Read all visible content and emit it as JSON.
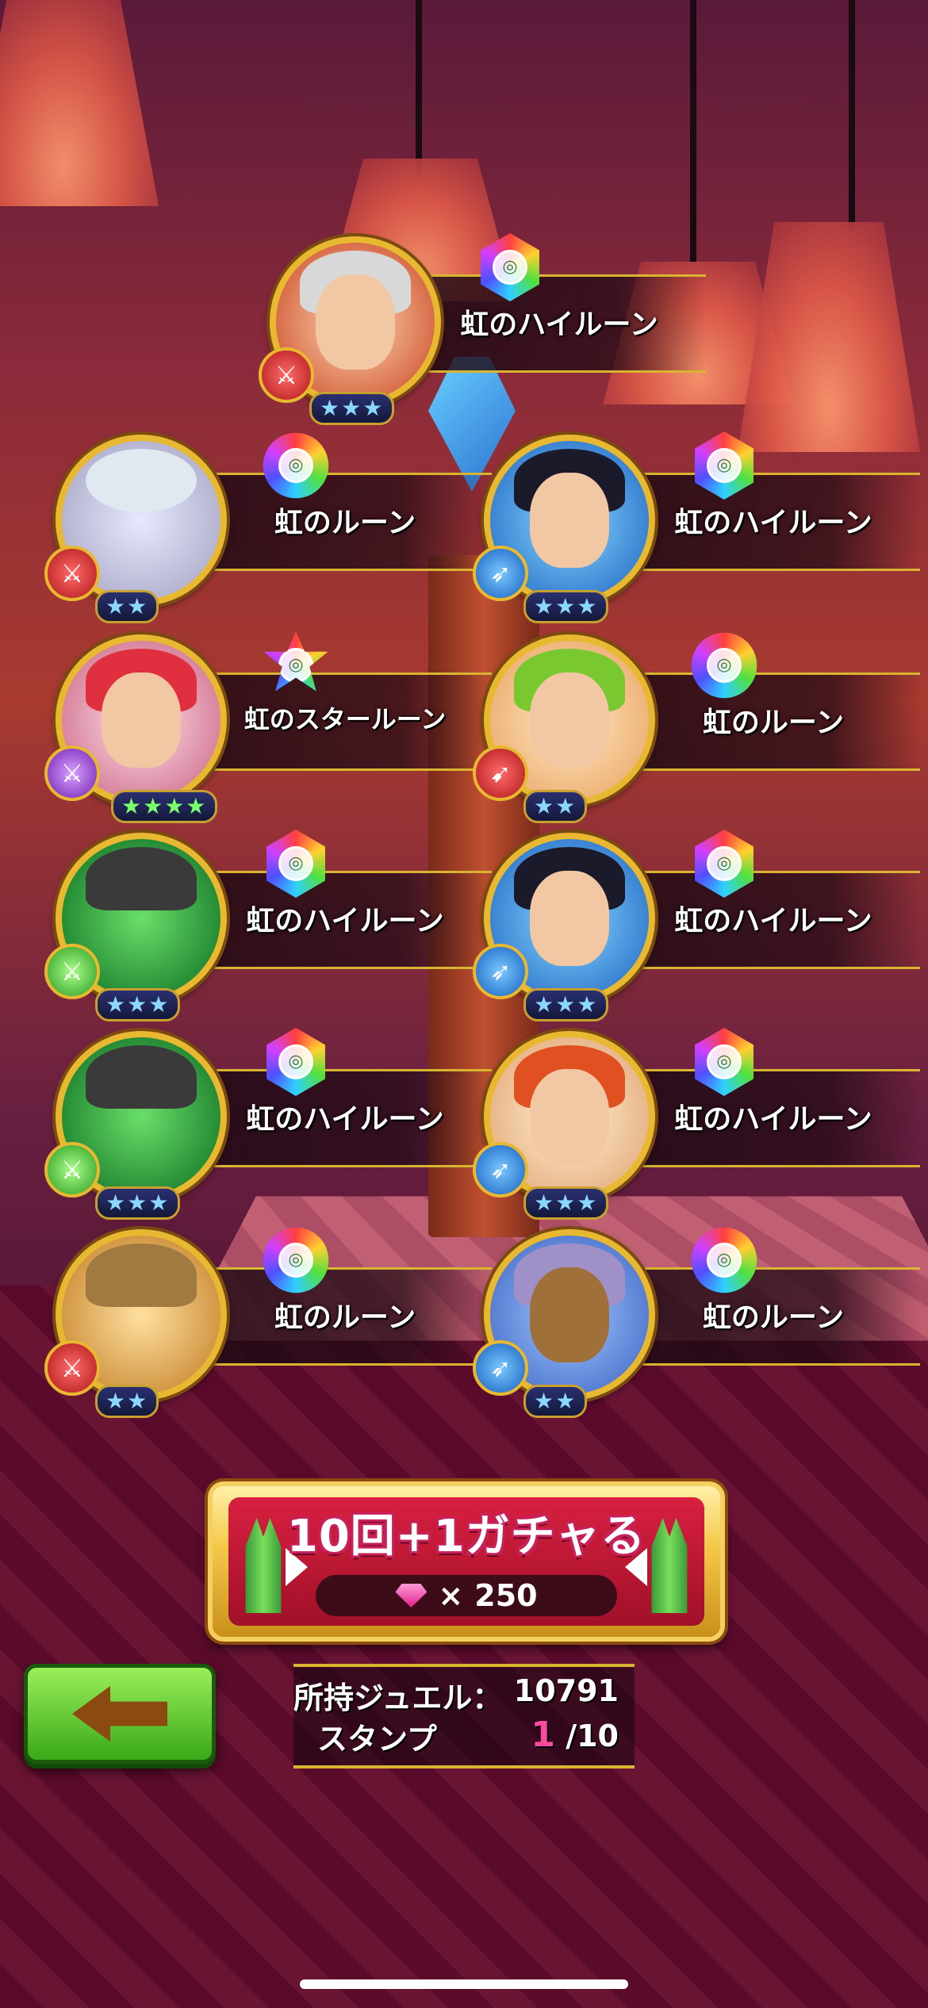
{
  "rewards": [
    {
      "name": "虹のハイルーン",
      "stars": "★★★",
      "weapon": "red",
      "gem": "hex"
    },
    {
      "name": "虹のルーン",
      "stars": "★★",
      "weapon": "red",
      "gem": "round"
    },
    {
      "name": "虹のハイルーン",
      "stars": "★★★",
      "weapon": "blue",
      "gem": "hex"
    },
    {
      "name": "虹のスタールーン",
      "stars": "★★★★",
      "weapon": "purple",
      "gem": "star"
    },
    {
      "name": "虹のルーン",
      "stars": "★★",
      "weapon": "red",
      "gem": "round"
    },
    {
      "name": "虹のハイルーン",
      "stars": "★★★",
      "weapon": "green",
      "gem": "hex"
    },
    {
      "name": "虹のハイルーン",
      "stars": "★★★",
      "weapon": "blue",
      "gem": "hex"
    },
    {
      "name": "虹のハイルーン",
      "stars": "★★★",
      "weapon": "green",
      "gem": "hex"
    },
    {
      "name": "虹のハイルーン",
      "stars": "★★★",
      "weapon": "blue",
      "gem": "hex"
    },
    {
      "name": "虹のルーン",
      "stars": "★★",
      "weapon": "red",
      "gem": "round"
    },
    {
      "name": "虹のルーン",
      "stars": "★★",
      "weapon": "blue",
      "gem": "round"
    }
  ],
  "gacha": {
    "title": "10回+1ガチャる",
    "cost_symbol": "×",
    "cost": "250"
  },
  "wallet": {
    "jewel_label": "所持ジュエル：",
    "jewel_value": "10791",
    "stamp_label": "スタンプ",
    "stamp_current": "1",
    "stamp_total": "/10"
  },
  "colors": {
    "gold": "#d8b430",
    "green_button": "#3aa818",
    "gacha_red": "#d82040"
  }
}
